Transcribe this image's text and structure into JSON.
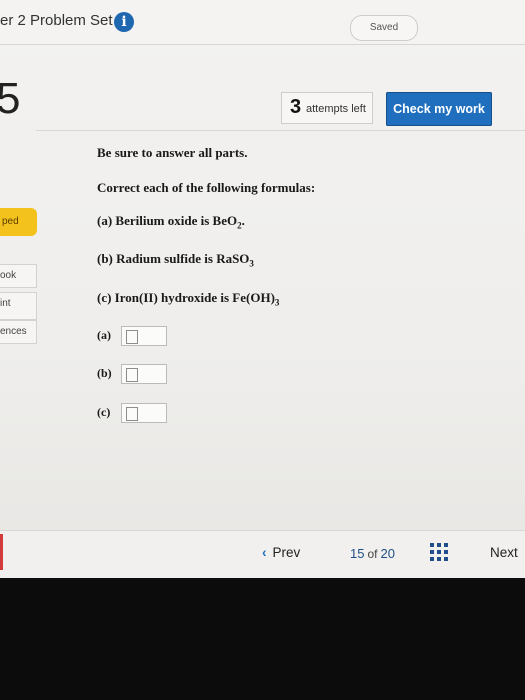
{
  "header": {
    "title": "er 2 Problem Set",
    "saved_label": "Saved"
  },
  "question": {
    "number": "5",
    "attempts_count": "3",
    "attempts_label": "attempts left",
    "check_button": "Check my work",
    "instruction": "Be sure to answer all parts.",
    "prompt": "Correct each of the following formulas:",
    "parts": [
      {
        "prefix": "(a) Berilium oxide is BeO",
        "sub": "2",
        "suffix": "."
      },
      {
        "prefix": "(b) Radium sulfide is RaSO",
        "sub": "3",
        "suffix": ""
      },
      {
        "prefix": "(c) Iron(II) hydroxide is Fe(OH)",
        "sub": "3",
        "suffix": ""
      }
    ],
    "answer_labels": [
      "(a)",
      "(b)",
      "(c)"
    ],
    "answer_values": [
      "",
      "",
      ""
    ]
  },
  "sidebar": {
    "items": [
      {
        "label": "ped"
      },
      {
        "label": "ook"
      },
      {
        "label": "int"
      },
      {
        "label": "ences"
      }
    ]
  },
  "footer": {
    "prev_label": "Prev",
    "page_current": "15",
    "page_of": "of",
    "page_total": "20",
    "next_label": "Next"
  },
  "colors": {
    "accent_blue": "#1f6fbe",
    "badge_yellow": "#f3c21c"
  }
}
